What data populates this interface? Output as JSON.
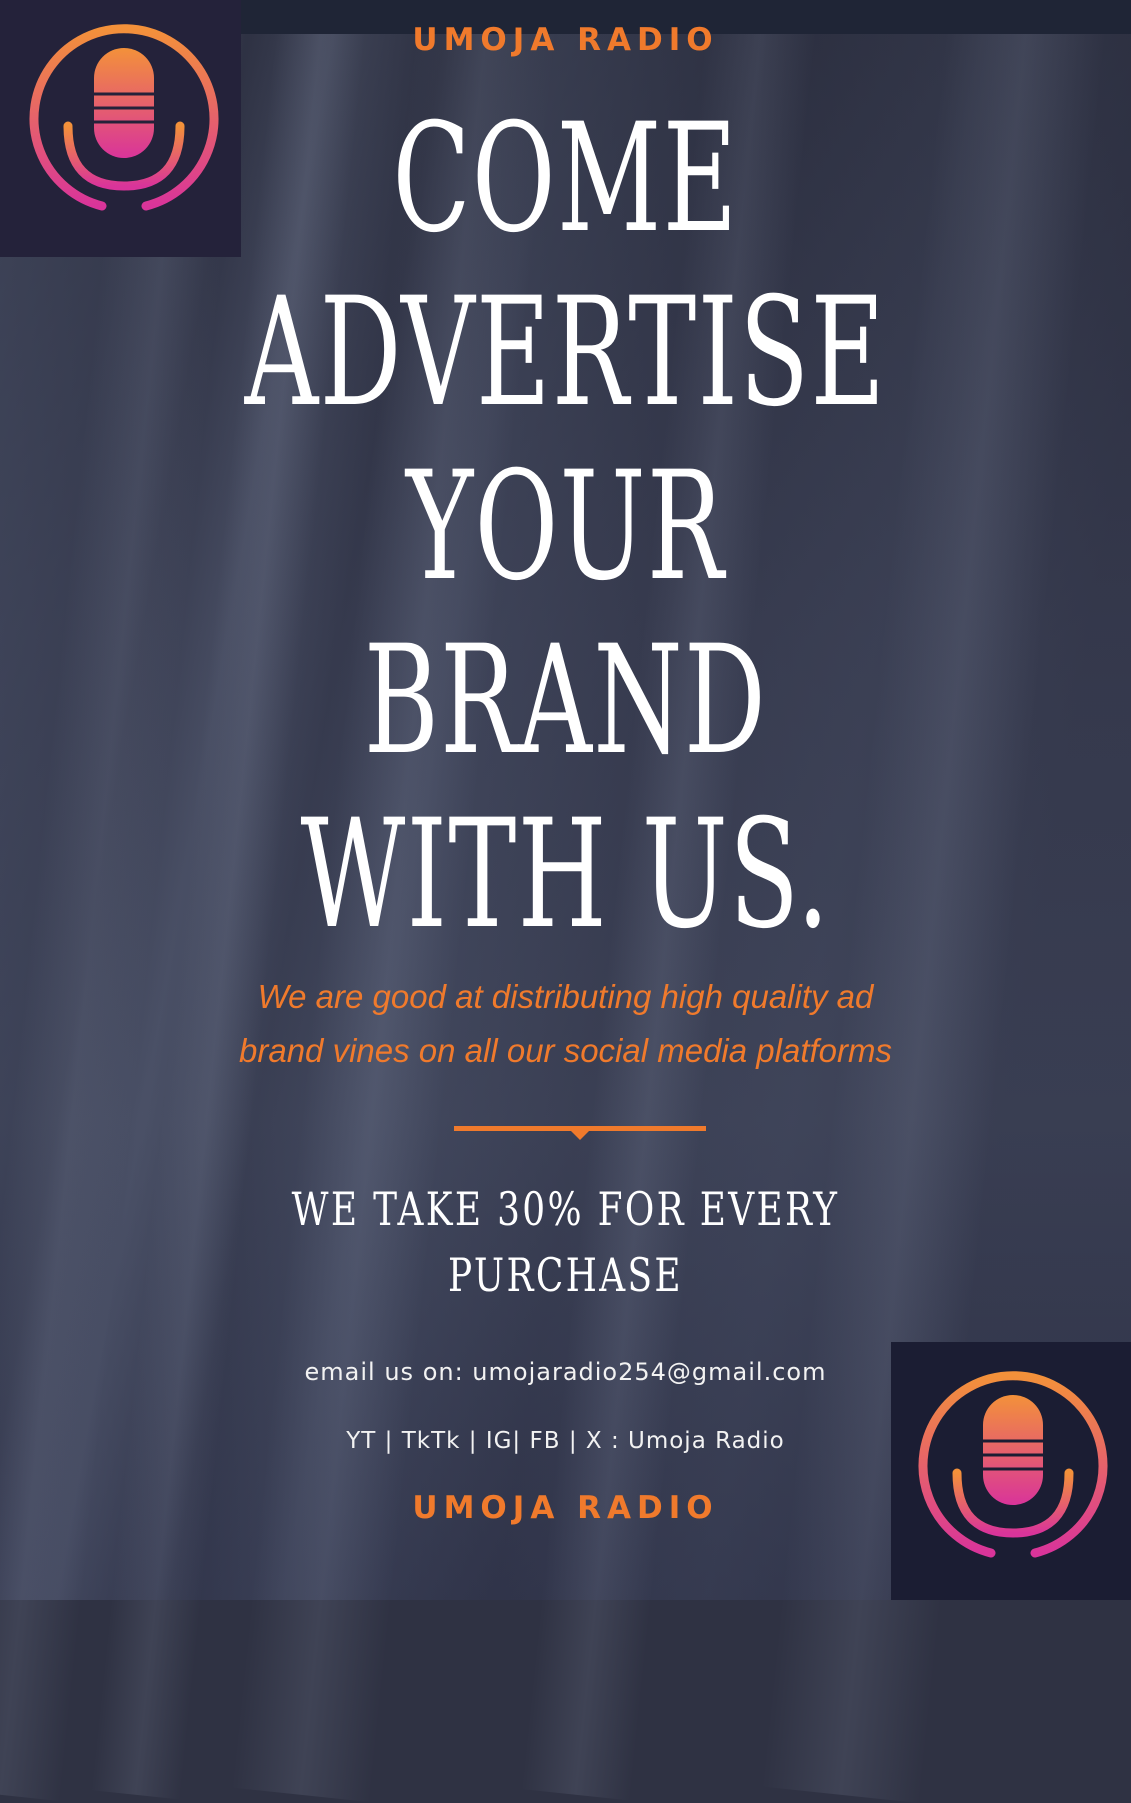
{
  "brand": {
    "name_top": "UMOJA RADIO",
    "name_bottom": "UMOJA RADIO"
  },
  "headline": {
    "lines": [
      "COME",
      "ADVERTISE",
      "YOUR",
      "BRAND",
      "WITH US."
    ]
  },
  "tagline": {
    "line1": "We are good at distributing high quality ad",
    "line2": "brand vines on all our social media platforms"
  },
  "offer": {
    "line1": "WE TAKE 30% FOR EVERY",
    "line2": "PURCHASE"
  },
  "contact": {
    "email_text": "email us on: umojaradio254@gmail.com"
  },
  "socials": {
    "text": "YT | TkTk | IG| FB | X : Umoja Radio"
  },
  "icons": {
    "logo": "podcast-microphone-logo-icon"
  },
  "colors": {
    "accent": "#f07a2c",
    "logo_gradient_start": "#f3913a",
    "logo_gradient_end": "#d9349a",
    "background": "#2f3243"
  }
}
